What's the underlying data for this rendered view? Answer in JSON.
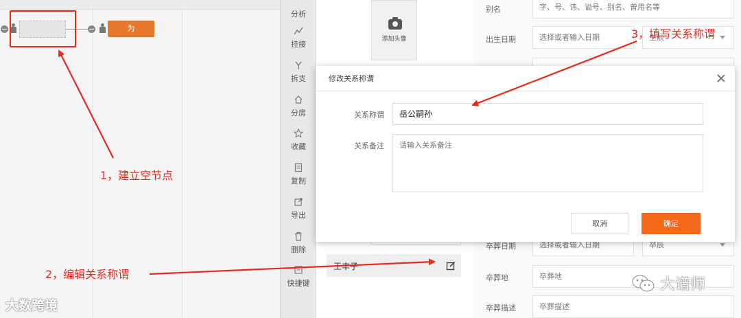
{
  "toolbar": {
    "items": [
      {
        "label": "分析",
        "icon": "analysis-icon"
      },
      {
        "label": "挂接",
        "icon": "link-icon"
      },
      {
        "label": "拆支",
        "icon": "split-branch-icon"
      },
      {
        "label": "分房",
        "icon": "home-icon"
      },
      {
        "label": "收藏",
        "icon": "star-icon"
      },
      {
        "label": "复制",
        "icon": "copy-icon"
      },
      {
        "label": "导出",
        "icon": "export-icon"
      },
      {
        "label": "删除",
        "icon": "trash-icon"
      },
      {
        "label": "快捷键",
        "icon": "shortcut-icon"
      }
    ]
  },
  "tree": {
    "node_label": "为"
  },
  "avatar": {
    "label": "添加头像"
  },
  "person": {
    "name": "王丰子"
  },
  "form": {
    "alias_label": "别名",
    "alias_placeholder": "字、号、讳、谥号、别名、曾用名等",
    "birth_label": "出生日期",
    "birth_placeholder": "选择或者输入日期",
    "birth_hour": "生辰",
    "burial_date_label": "卒葬日期",
    "burial_date_placeholder": "选择或者输入日期",
    "burial_hour": "卒辰",
    "burial_place_label": "卒葬地",
    "burial_place_placeholder": "卒葬地",
    "burial_desc_label": "卒葬描述",
    "burial_desc_placeholder": "卒葬描述"
  },
  "dialog": {
    "title": "修改关系称谓",
    "relation_label": "关系称谓",
    "relation_value": "岳公嗣孙",
    "note_label": "关系备注",
    "note_placeholder": "请输入关系备注",
    "cancel": "取消",
    "confirm": "确定"
  },
  "annotations": {
    "step1": "1，建立空节点",
    "step2": "2，编辑关系称谓",
    "step3": "3，填写关系称谓"
  },
  "watermarks": {
    "left": "大数跨境",
    "right": "大谱师"
  },
  "colors": {
    "accent": "#f26a19",
    "annotation": "#e8291f",
    "node": "#e8772e"
  }
}
